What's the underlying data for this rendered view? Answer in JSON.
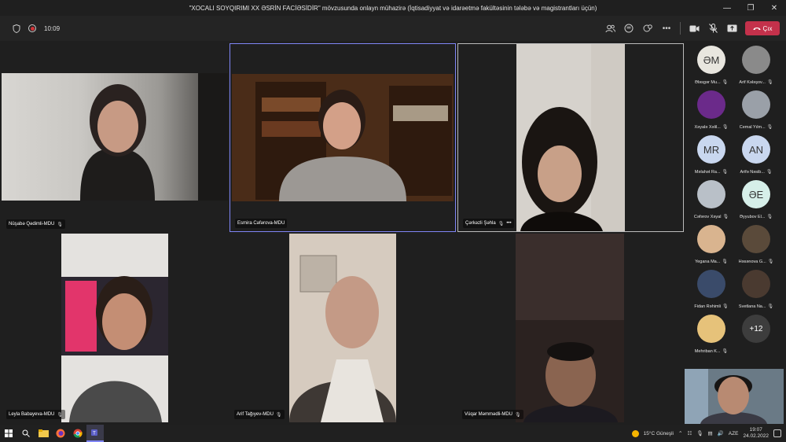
{
  "window": {
    "title": "\"XOCALI SOYQIRIMI XX ƏSRİN FACİƏSİDİR\" mövzusunda onlayn mühazirə (İqtisadiyyat və idarəetmə fakültəsinin tələbə və magistrantları üçün)"
  },
  "meeting": {
    "timer": "10:09",
    "leave_label": "Çıx"
  },
  "tiles": [
    {
      "name": "Nüşabə Qədimli-MDU",
      "muted": true
    },
    {
      "name": "Esmira Cəfərova-MDU",
      "muted": false
    },
    {
      "name": "Çərkəzli Şəhla",
      "muted": true
    },
    {
      "name": "Leyla Babayeva-MDU",
      "muted": true
    },
    {
      "name": "Arif Tağıyev-MDU",
      "muted": true
    },
    {
      "name": "Vüqar Məmmədli-MDU",
      "muted": true
    }
  ],
  "roster": [
    {
      "name": "Ələsgər Mu...",
      "initials": "ƏM",
      "avatar_color": "#e8e6df"
    },
    {
      "name": "Arif Kələşov...",
      "initials": "",
      "avatar_color": "#8a8a8a"
    },
    {
      "name": "Xəyalə Xəlil...",
      "initials": "",
      "avatar_color": "#6b2a8a"
    },
    {
      "name": "Cemal Yılm...",
      "initials": "",
      "avatar_color": "#9aa0a8"
    },
    {
      "name": "Məlahət Ra...",
      "initials": "MR",
      "avatar_color": "#c9d7ef"
    },
    {
      "name": "Arifə Nəsib...",
      "initials": "AN",
      "avatar_color": "#c9d7ef"
    },
    {
      "name": "Cəfərov Xəyal",
      "initials": "",
      "avatar_color": "#b9c0c8"
    },
    {
      "name": "Əyyubov El...",
      "initials": "ƏE",
      "avatar_color": "#d6efe9"
    },
    {
      "name": "Yegana Ma...",
      "initials": "",
      "avatar_color": "#d9b48f"
    },
    {
      "name": "Həsənova G...",
      "initials": "",
      "avatar_color": "#5a4a3a"
    },
    {
      "name": "Fidan Rəhimli",
      "initials": "",
      "avatar_color": "#3a4b6a"
    },
    {
      "name": "Svetlana Na...",
      "initials": "",
      "avatar_color": "#4a3a30"
    },
    {
      "name": "Mehriban K...",
      "initials": "",
      "avatar_color": "#e6c27a"
    },
    {
      "name": "",
      "initials": "+12",
      "avatar_color": "#3d3d3d"
    }
  ],
  "taskbar": {
    "weather": "15°C  Güneşli",
    "language": "AZE",
    "time": "19:07",
    "date": "24.02.2022"
  }
}
